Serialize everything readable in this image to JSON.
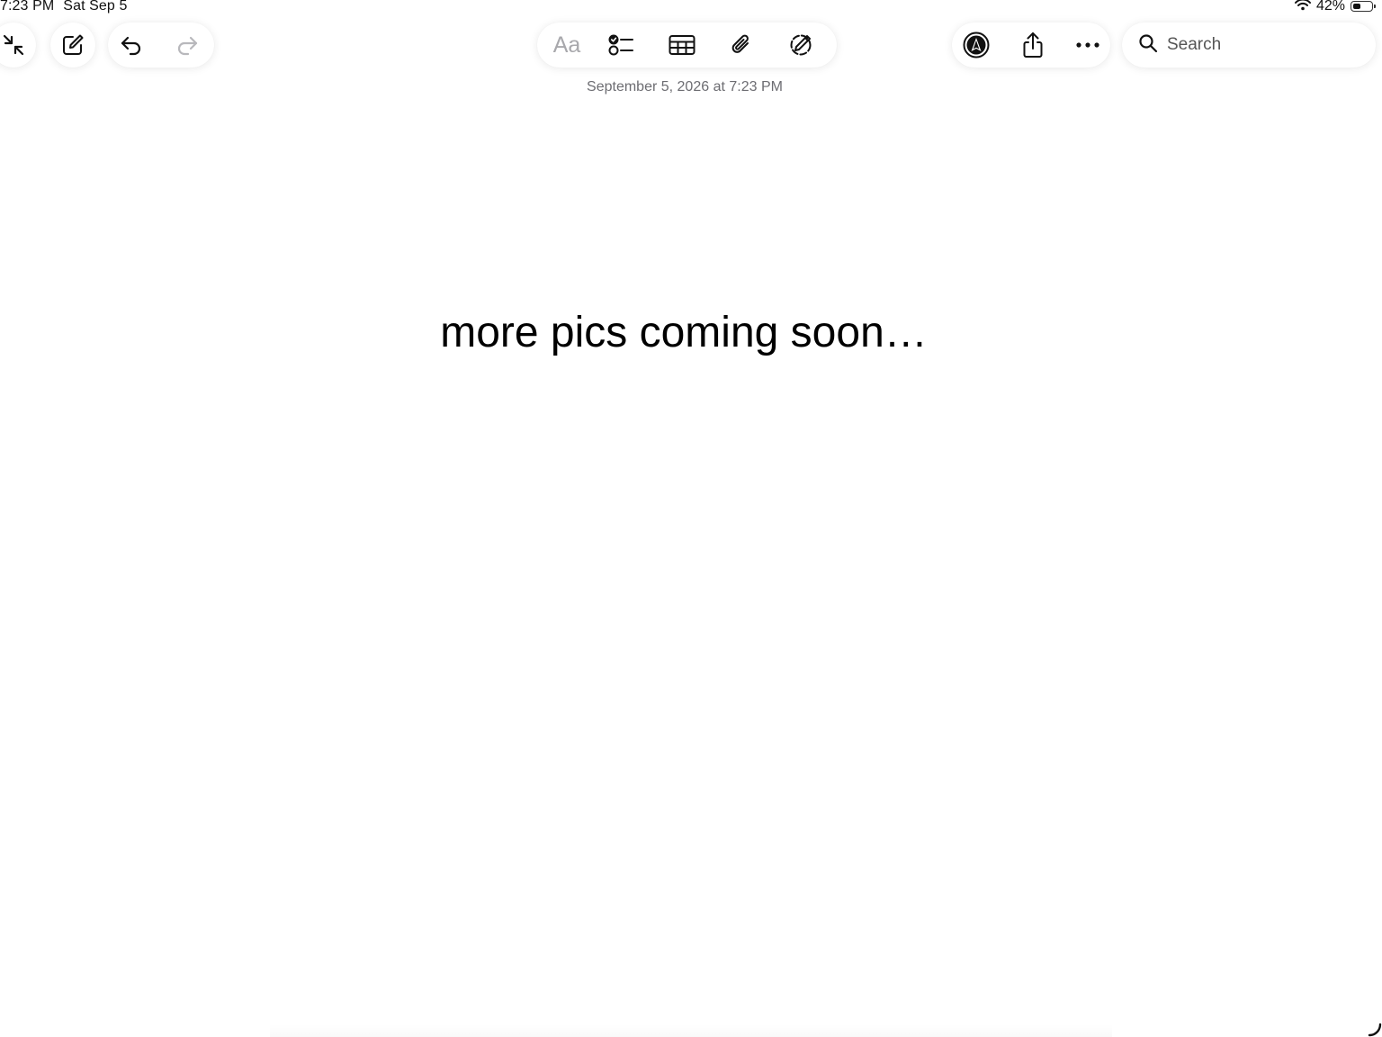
{
  "status_bar": {
    "time": "7:23 PM",
    "date": "Sat Sep 5",
    "battery_text": "42%",
    "battery_level": 0.42
  },
  "toolbar": {
    "left_icons": [
      "collapse-arrows-icon",
      "compose-icon",
      "undo-icon",
      "redo-icon"
    ],
    "format_label": "Aa",
    "center_icons": [
      "checklist-icon",
      "table-icon",
      "paperclip-icon",
      "markup-pen-icon"
    ],
    "right_icons": [
      "navigator-icon",
      "share-icon",
      "more-ellipsis-icon"
    ]
  },
  "note": {
    "date_stamp": "September 5, 2026 at 7:23 PM",
    "body_text": "more pics coming soon…"
  },
  "search": {
    "placeholder": "Search",
    "value": ""
  },
  "colors": {
    "text": "#000000",
    "secondary_text": "#6d6d72",
    "disabled_icon": "#b8b8bc",
    "background": "#ffffff"
  }
}
